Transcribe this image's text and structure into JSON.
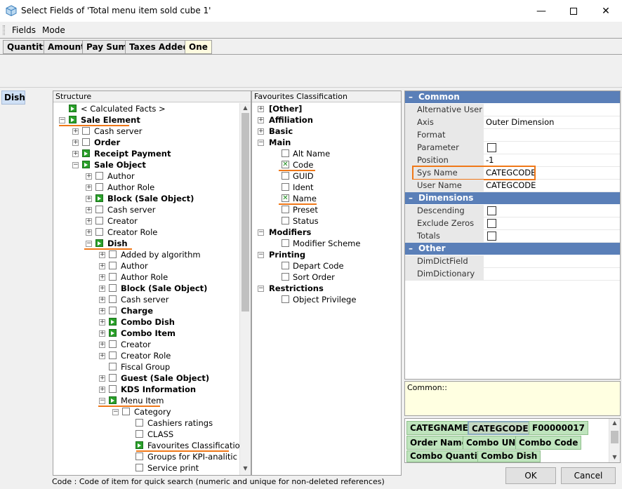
{
  "window": {
    "title": "Select Fields of 'Total menu item sold cube 1'",
    "minimize_icon": "minimize-icon",
    "maximize_icon": "maximize-icon",
    "close_icon": "close-icon"
  },
  "menu": {
    "fields": "Fields",
    "mode": "Mode"
  },
  "measure_tabs": [
    "Quantity",
    "Amount",
    "Pay Sum",
    "Taxes Added",
    "One"
  ],
  "dimension_button": "Dish",
  "structure": {
    "header": "Structure",
    "rows": [
      {
        "label": "< Calculated Facts >",
        "bold": false,
        "icon": "arrow"
      },
      {
        "label": "Sale Element",
        "bold": true,
        "icon": "arrow"
      },
      {
        "label": "Cash server",
        "bold": false,
        "icon": "box"
      },
      {
        "label": "Order",
        "bold": true,
        "icon": "box"
      },
      {
        "label": "Receipt Payment",
        "bold": true,
        "icon": "arrow"
      },
      {
        "label": "Sale Object",
        "bold": true,
        "icon": "arrow"
      },
      {
        "label": "Author",
        "bold": false,
        "icon": "box"
      },
      {
        "label": "Author Role",
        "bold": false,
        "icon": "box"
      },
      {
        "label": "Block (Sale Object)",
        "bold": true,
        "icon": "arrow"
      },
      {
        "label": "Cash server",
        "bold": false,
        "icon": "box"
      },
      {
        "label": "Creator",
        "bold": false,
        "icon": "box"
      },
      {
        "label": "Creator Role",
        "bold": false,
        "icon": "box"
      },
      {
        "label": "Dish",
        "bold": true,
        "icon": "arrow"
      },
      {
        "label": "Added by algorithm",
        "bold": false,
        "icon": "box"
      },
      {
        "label": "Author",
        "bold": false,
        "icon": "box"
      },
      {
        "label": "Author Role",
        "bold": false,
        "icon": "box"
      },
      {
        "label": "Block (Sale Object)",
        "bold": true,
        "icon": "box"
      },
      {
        "label": "Cash server",
        "bold": false,
        "icon": "box"
      },
      {
        "label": "Charge",
        "bold": true,
        "icon": "box"
      },
      {
        "label": "Combo Dish",
        "bold": true,
        "icon": "arrow"
      },
      {
        "label": "Combo Item",
        "bold": true,
        "icon": "arrow"
      },
      {
        "label": "Creator",
        "bold": false,
        "icon": "box"
      },
      {
        "label": "Creator Role",
        "bold": false,
        "icon": "box"
      },
      {
        "label": "Fiscal Group",
        "bold": false,
        "icon": "box"
      },
      {
        "label": "Guest (Sale Object)",
        "bold": true,
        "icon": "box"
      },
      {
        "label": "KDS Information",
        "bold": true,
        "icon": "box"
      },
      {
        "label": "Menu Item",
        "bold": false,
        "icon": "arrow"
      },
      {
        "label": "Category",
        "bold": false,
        "icon": "box"
      },
      {
        "label": "Cashiers ratings",
        "bold": false,
        "icon": "box"
      },
      {
        "label": "CLASS",
        "bold": false,
        "icon": "box"
      },
      {
        "label": "Favourites Classification",
        "bold": false,
        "icon": "arrow"
      },
      {
        "label": "Groups for KPI-analitic",
        "bold": false,
        "icon": "box"
      },
      {
        "label": "Service print",
        "bold": false,
        "icon": "box"
      }
    ]
  },
  "favourites": {
    "header": "Favourites Classification",
    "rows": [
      {
        "label": "[Other]",
        "bold": true
      },
      {
        "label": "Affiliation",
        "bold": true
      },
      {
        "label": "Basic",
        "bold": true
      },
      {
        "label": "Main",
        "bold": true
      },
      {
        "label": "Alt Name",
        "bold": false
      },
      {
        "label": "Code",
        "bold": false
      },
      {
        "label": "GUID",
        "bold": false
      },
      {
        "label": "Ident",
        "bold": false
      },
      {
        "label": "Name",
        "bold": false
      },
      {
        "label": "Preset",
        "bold": false
      },
      {
        "label": "Status",
        "bold": false
      },
      {
        "label": "Modifiers",
        "bold": true
      },
      {
        "label": "Modifier Scheme",
        "bold": false
      },
      {
        "label": "Printing",
        "bold": true
      },
      {
        "label": "Depart Code",
        "bold": false
      },
      {
        "label": "Sort Order",
        "bold": false
      },
      {
        "label": "Restrictions",
        "bold": true
      },
      {
        "label": "Object Privilege",
        "bold": false
      }
    ]
  },
  "properties": {
    "common": "Common",
    "dimensions": "Dimensions",
    "other": "Other",
    "rows": {
      "alt_user_name": {
        "name": "Alternative User Na",
        "value": ""
      },
      "axis": {
        "name": "Axis",
        "value": "Outer Dimension"
      },
      "format": {
        "name": "Format",
        "value": ""
      },
      "parameter": {
        "name": "Parameter"
      },
      "position": {
        "name": "Position",
        "value": "-1"
      },
      "sys_name": {
        "name": "Sys Name",
        "value": "CATEGCODE"
      },
      "user_name": {
        "name": "User Name",
        "value": "CATEGCODE"
      },
      "descending": {
        "name": "Descending"
      },
      "exclude_zeros": {
        "name": "Exclude Zeros"
      },
      "totals": {
        "name": "Totals"
      },
      "dimdictfield": {
        "name": "DimDictField",
        "value": ""
      },
      "dimdictionary": {
        "name": "DimDictionary",
        "value": ""
      }
    },
    "description": "Common::"
  },
  "field_chips": [
    "CATEGNAME",
    "CATEGCODE",
    "F00000017",
    "Order Name",
    "Combo UNI",
    "Combo Code",
    "Combo Quantity",
    "Combo Dish"
  ],
  "status": "Code : Code of item for quick search (numeric and unique for non-deleted references)",
  "buttons": {
    "ok": "OK",
    "cancel": "Cancel"
  },
  "colors": {
    "highlight": "#f07818",
    "section": "#5a7fb8",
    "chip": "#bfe4bd"
  }
}
